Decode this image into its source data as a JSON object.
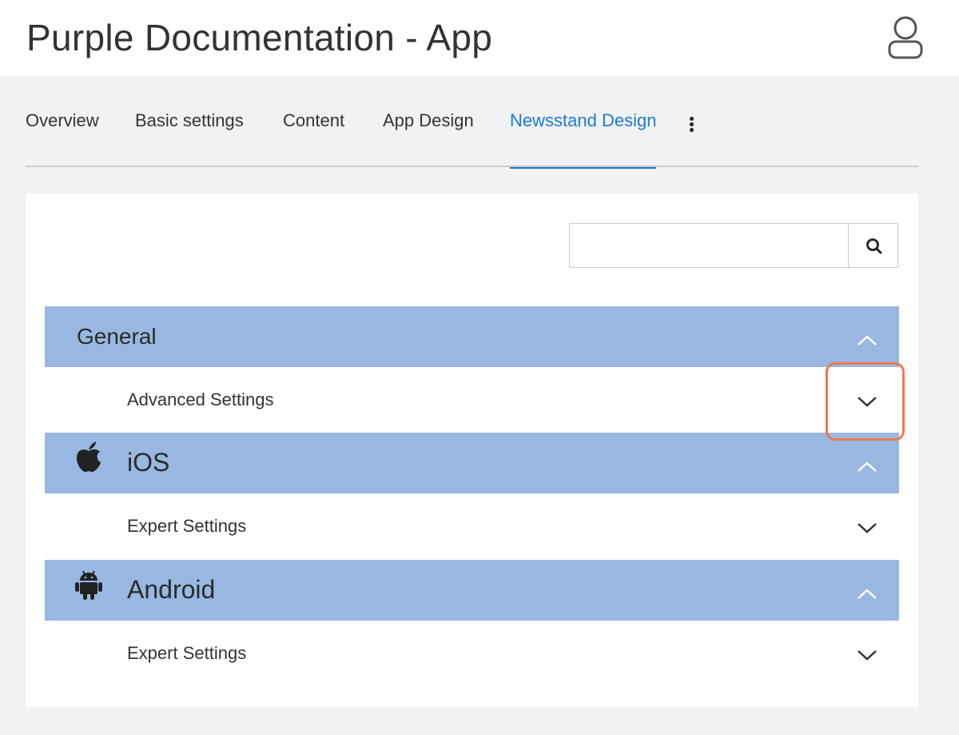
{
  "app": {
    "title": "Purple Documentation - App"
  },
  "header": {
    "user_icon": "user-icon"
  },
  "tabs": [
    {
      "label": "Overview"
    },
    {
      "label": "Basic settings"
    },
    {
      "label": "Content"
    },
    {
      "label": "App Design"
    },
    {
      "label": "Newsstand Design",
      "active": true
    }
  ],
  "more_menu": {
    "icon": "vertical-ellipsis-icon"
  },
  "search": {
    "value": "",
    "placeholder": "",
    "icon": "search-icon"
  },
  "sections": [
    {
      "title": "General",
      "icon": null,
      "expanded": true,
      "rows": [
        {
          "label": "Advanced Settings",
          "highlighted": true
        }
      ]
    },
    {
      "title": "iOS",
      "icon": "apple-icon",
      "expanded": true,
      "rows": [
        {
          "label": "Expert Settings"
        }
      ]
    },
    {
      "title": "Android",
      "icon": "android-icon",
      "expanded": true,
      "rows": [
        {
          "label": "Expert Settings"
        }
      ]
    }
  ],
  "colors": {
    "accent": "#1a7bd6",
    "section_bg": "#98b8e1",
    "highlight": "#f07848",
    "page_bg": "#f2f2f2"
  }
}
